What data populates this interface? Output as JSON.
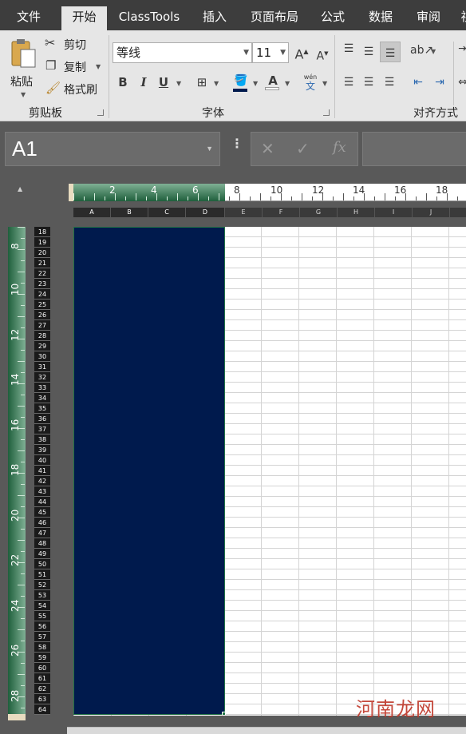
{
  "tabs": [
    "文件",
    "开始",
    "ClassTools",
    "插入",
    "页面布局",
    "公式",
    "数据",
    "审阅",
    "视"
  ],
  "active_tab_index": 1,
  "clipboard": {
    "paste_label": "粘贴",
    "cut_label": "剪切",
    "copy_label": "复制",
    "format_painter_label": "格式刷",
    "group_label": "剪贴板"
  },
  "font": {
    "font_name": "等线",
    "font_size": "11",
    "bold": "B",
    "italic": "I",
    "underline": "U",
    "grow": "A",
    "shrink": "A",
    "font_color": "A",
    "phonetic": "wén",
    "group_label": "字体"
  },
  "alignment": {
    "group_label": "对齐方式"
  },
  "name_box": "A1",
  "formula_bar": {
    "cancel_icon": "✕",
    "enter_icon": "✓",
    "fx_label": "fx",
    "value": ""
  },
  "horizontal_ruler": [
    "2",
    "4",
    "6",
    "8",
    "10",
    "12",
    "14",
    "16",
    "18"
  ],
  "vertical_ruler": [
    "8",
    "10",
    "12",
    "14",
    "16",
    "18",
    "20",
    "22",
    "24",
    "26",
    "28"
  ],
  "columns": [
    "A",
    "B",
    "C",
    "D",
    "E",
    "F",
    "G",
    "H",
    "I",
    "J"
  ],
  "selected_columns": [
    "A",
    "B",
    "C",
    "D"
  ],
  "rows": [
    "18",
    "19",
    "20",
    "21",
    "22",
    "23",
    "24",
    "25",
    "26",
    "27",
    "28",
    "29",
    "30",
    "31",
    "32",
    "33",
    "34",
    "35",
    "36",
    "37",
    "38",
    "39",
    "40",
    "41",
    "42",
    "43",
    "44",
    "45",
    "46",
    "47",
    "48",
    "49",
    "50",
    "51",
    "52",
    "53",
    "54",
    "55",
    "56",
    "57",
    "58",
    "59",
    "60",
    "61",
    "62",
    "63",
    "64"
  ],
  "selection_fill_color": "#001a4d",
  "selection_border_color": "#217346",
  "watermark": "河南龙网"
}
